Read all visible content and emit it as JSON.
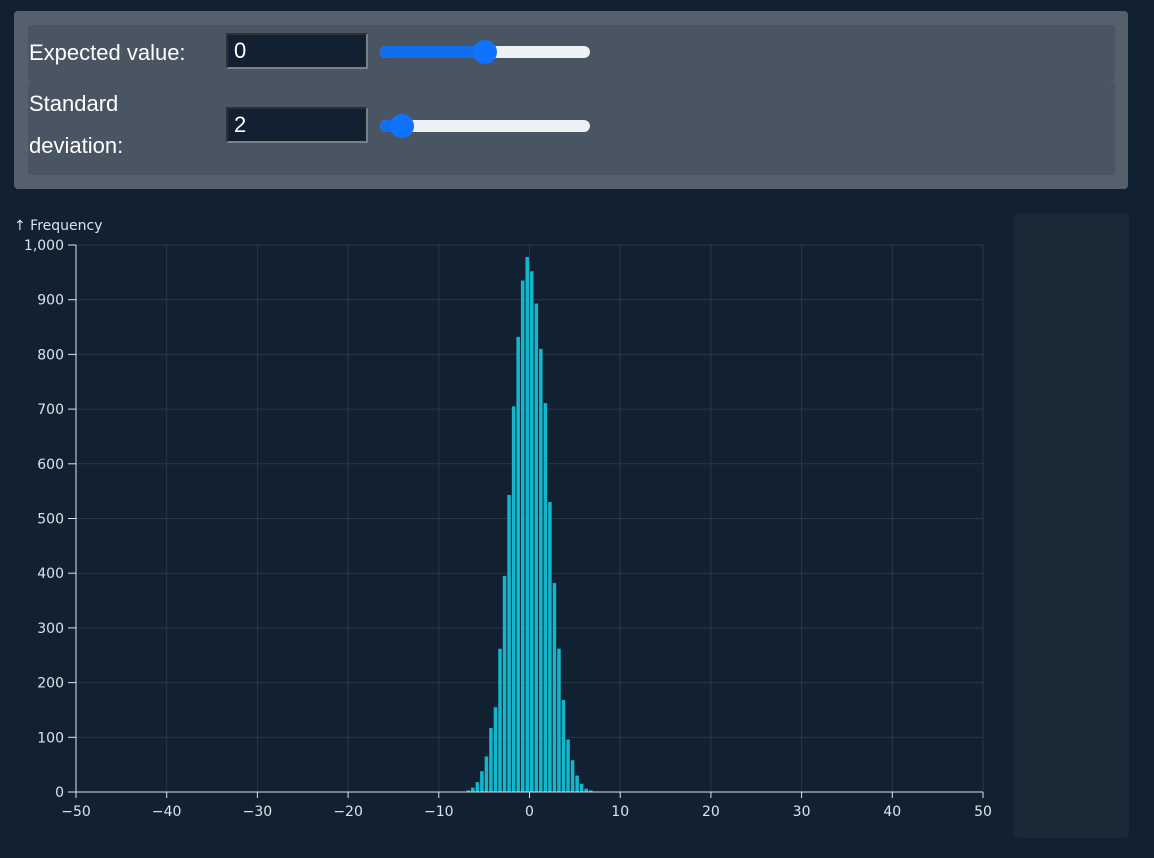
{
  "controls": {
    "expected": {
      "label": "Expected value:",
      "value": "0",
      "slider_min": -10,
      "slider_max": 10,
      "slider_value": 0
    },
    "stddev": {
      "label": "Standard deviation:",
      "value": "2",
      "slider_min": 1,
      "slider_max": 20,
      "slider_value": 2
    }
  },
  "colors": {
    "background": "#112132",
    "bar": "#14b6cc",
    "grid": "#26384a",
    "axis_text": "#dde3ea",
    "slider_accent": "#0f73ff"
  },
  "chart_data": {
    "type": "bar",
    "ylabel": "↑ Frequency",
    "xlabel": "",
    "xlim": [
      -50,
      50
    ],
    "ylim": [
      0,
      1000
    ],
    "xticks": [
      -50,
      -40,
      -30,
      -20,
      -10,
      0,
      10,
      20,
      30,
      40,
      50
    ],
    "yticks": [
      0,
      100,
      200,
      300,
      400,
      500,
      600,
      700,
      800,
      900,
      1000
    ],
    "xtick_labels": [
      "−50",
      "−40",
      "−30",
      "−20",
      "−10",
      "0",
      "10",
      "20",
      "30",
      "40",
      "50"
    ],
    "ytick_labels": [
      "0",
      "100",
      "200",
      "300",
      "400",
      "500",
      "600",
      "700",
      "800",
      "900",
      "1,000"
    ],
    "grid": true,
    "bin_width": 0.5,
    "bins": [
      {
        "x0": -7.0,
        "value": 3
      },
      {
        "x0": -6.5,
        "value": 8
      },
      {
        "x0": -6.0,
        "value": 18
      },
      {
        "x0": -5.5,
        "value": 38
      },
      {
        "x0": -5.0,
        "value": 65
      },
      {
        "x0": -4.5,
        "value": 117
      },
      {
        "x0": -4.0,
        "value": 155
      },
      {
        "x0": -3.5,
        "value": 262
      },
      {
        "x0": -3.0,
        "value": 395
      },
      {
        "x0": -2.5,
        "value": 543
      },
      {
        "x0": -2.0,
        "value": 705
      },
      {
        "x0": -1.5,
        "value": 832
      },
      {
        "x0": -1.0,
        "value": 935
      },
      {
        "x0": -0.5,
        "value": 978
      },
      {
        "x0": 0.0,
        "value": 952
      },
      {
        "x0": 0.5,
        "value": 893
      },
      {
        "x0": 1.0,
        "value": 810
      },
      {
        "x0": 1.5,
        "value": 711
      },
      {
        "x0": 2.0,
        "value": 530
      },
      {
        "x0": 2.5,
        "value": 382
      },
      {
        "x0": 3.0,
        "value": 262
      },
      {
        "x0": 3.5,
        "value": 168
      },
      {
        "x0": 4.0,
        "value": 96
      },
      {
        "x0": 4.5,
        "value": 58
      },
      {
        "x0": 5.0,
        "value": 30
      },
      {
        "x0": 5.5,
        "value": 15
      },
      {
        "x0": 6.0,
        "value": 6
      },
      {
        "x0": 6.5,
        "value": 3
      },
      {
        "x0": 7.0,
        "value": 1
      }
    ]
  }
}
